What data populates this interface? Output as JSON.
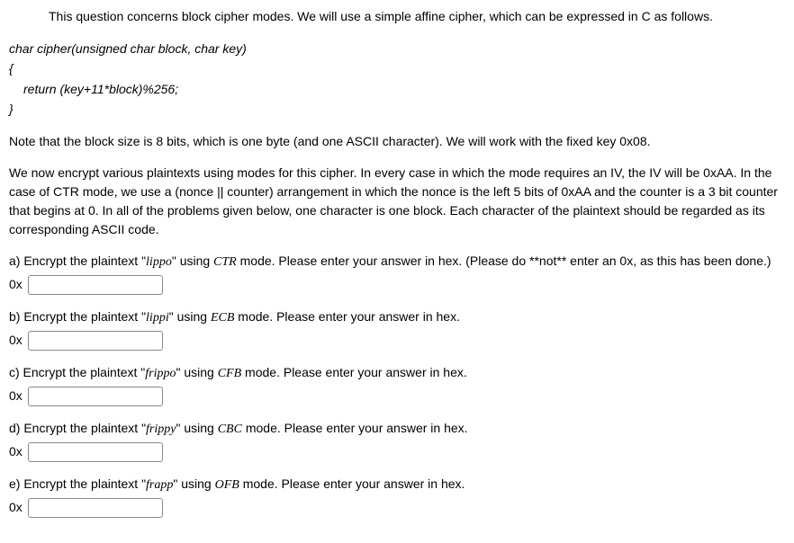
{
  "intro": "This question concerns block cipher modes. We will use a simple affine cipher, which can be expressed in C as follows.",
  "code": {
    "sig": "char cipher(unsigned char block, char key)",
    "open": "{",
    "body": "return (key+11*block)%256;",
    "close": "}"
  },
  "note": "Note that the block size is 8 bits, which is one byte (and one ASCII character). We will work with the fixed key 0x08.",
  "setup": "We now encrypt various plaintexts using modes for this cipher. In every case in which the mode requires an IV, the IV will be 0xAA. In the case of CTR mode, we use a (nonce || counter) arrangement in which the nonce is the left 5 bits of 0xAA and the counter is a 3 bit counter that begins at 0. In all of the problems given below, one character is one block. Each character of the plaintext should be regarded as its corresponding ASCII code.",
  "sub": {
    "a": {
      "pre": "a) Encrypt the plaintext \"",
      "pt": "lippo",
      "mid": "\" using ",
      "mode": "CTR",
      "post": " mode. Please enter your answer in hex. (Please do **not** enter an 0x, as this has been done.)",
      "prefix": "0x"
    },
    "b": {
      "pre": "b) Encrypt the plaintext \"",
      "pt": "lippi",
      "mid": "\" using ",
      "mode": "ECB",
      "post": " mode. Please enter your answer in hex.",
      "prefix": "0x"
    },
    "c": {
      "pre": "c) Encrypt the plaintext \"",
      "pt": "frippo",
      "mid": "\" using ",
      "mode": "CFB",
      "post": " mode. Please enter your answer in hex.",
      "prefix": "0x"
    },
    "d": {
      "pre": "d) Encrypt the plaintext \"",
      "pt": "frippy",
      "mid": "\" using ",
      "mode": "CBC",
      "post": " mode. Please enter your answer in hex.",
      "prefix": "0x"
    },
    "e": {
      "pre": "e) Encrypt the plaintext \"",
      "pt": "frapp",
      "mid": "\" using ",
      "mode": "OFB",
      "post": " mode. Please enter your answer in hex.",
      "prefix": "0x"
    }
  }
}
